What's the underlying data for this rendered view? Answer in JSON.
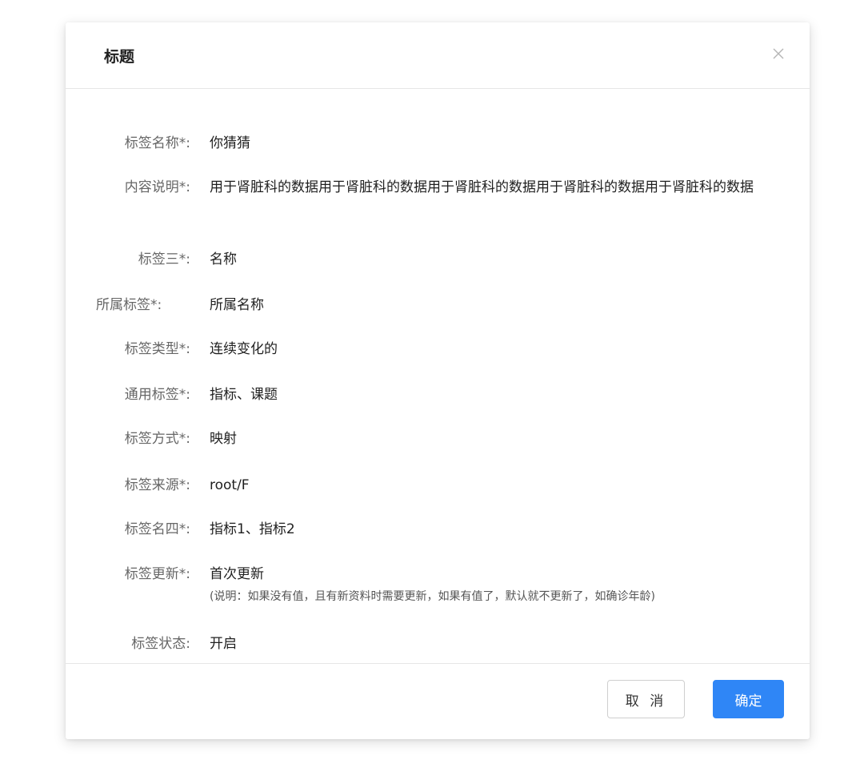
{
  "dialog": {
    "title": "标题",
    "close_icon": "close-icon"
  },
  "fields": [
    {
      "label": "标签名称*:",
      "value": "你猜猜"
    },
    {
      "label": "内容说明*:",
      "value": "用于肾脏科的数据用于肾脏科的数据用于肾脏科的数据用于肾脏科的数据用于肾脏科的数据"
    },
    {
      "label": "标签三*:",
      "value": "名称"
    },
    {
      "label": "所属标签*:",
      "value": "所属名称"
    },
    {
      "label": "标签类型*:",
      "value": "连续变化的"
    },
    {
      "label": "通用标签*:",
      "value": "指标、课题"
    },
    {
      "label": "标签方式*:",
      "value": "映射"
    },
    {
      "label": "标签来源*:",
      "value": "root/F"
    },
    {
      "label": "标签名四*:",
      "value": "指标1、指标2"
    },
    {
      "label": "标签更新*:",
      "value": "首次更新",
      "note": "(说明：如果没有值，且有新资料时需要更新，如果有值了，默认就不更新了，如确诊年龄)"
    },
    {
      "label": "标签状态:",
      "value": "开启"
    }
  ],
  "footer": {
    "cancel_label": "取 消",
    "ok_label": "确定"
  },
  "colors": {
    "primary": "#2f86f6",
    "label": "#666666",
    "text": "#1f1f1f",
    "divider": "#e6e6e6"
  }
}
